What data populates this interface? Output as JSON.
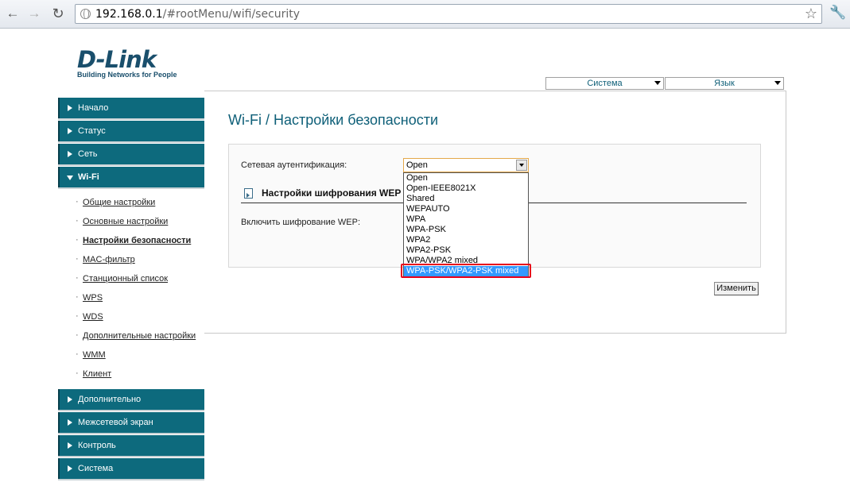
{
  "browser": {
    "url_host": "192.168.0.1",
    "url_path": "/#rootMenu/wifi/security"
  },
  "icons": {
    "back": "back-arrow-icon",
    "forward": "forward-arrow-icon",
    "reload": "reload-icon",
    "globe": "globe-icon",
    "star": "star-icon",
    "wrench": "wrench-icon"
  },
  "logo": {
    "name": "D-Link",
    "tagline": "Building Networks for People"
  },
  "top_menu": {
    "system": "Система",
    "language": "Язык"
  },
  "sidebar": {
    "items_top": [
      {
        "label": "Начало"
      },
      {
        "label": "Статус"
      },
      {
        "label": "Сеть"
      },
      {
        "label": "Wi-Fi"
      }
    ],
    "wifi_sub": [
      {
        "label": "Общие настройки"
      },
      {
        "label": "Основные настройки"
      },
      {
        "label": "Настройки безопасности"
      },
      {
        "label": "MAC-фильтр"
      },
      {
        "label": "Станционный список"
      },
      {
        "label": "WPS"
      },
      {
        "label": "WDS"
      },
      {
        "label": "Дополнительные настройки"
      },
      {
        "label": "WMM"
      },
      {
        "label": "Клиент"
      }
    ],
    "items_bottom": [
      {
        "label": "Дополнительно"
      },
      {
        "label": "Межсетевой экран"
      },
      {
        "label": "Контроль"
      },
      {
        "label": "Система"
      }
    ]
  },
  "page": {
    "title": "Wi-Fi  / Настройки безопасности",
    "auth_label": "Сетевая аутентификация:",
    "section_title": "Настройки шифрования WEP",
    "wep_label": "Включить шифрование WEP:",
    "change_button": "Изменить"
  },
  "auth_select": {
    "value": "Open",
    "options": [
      "Open",
      "Open-IEEE8021X",
      "Shared",
      "WEPAUTO",
      "WPA",
      "WPA-PSK",
      "WPA2",
      "WPA2-PSK",
      "WPA/WPA2 mixed",
      "WPA-PSK/WPA2-PSK mixed"
    ],
    "highlighted": "WPA-PSK/WPA2-PSK mixed"
  },
  "colors": {
    "accent": "#0d6a7d",
    "title": "#0e5f78",
    "highlight_border": "#e8001a",
    "selection": "#3399ff"
  }
}
